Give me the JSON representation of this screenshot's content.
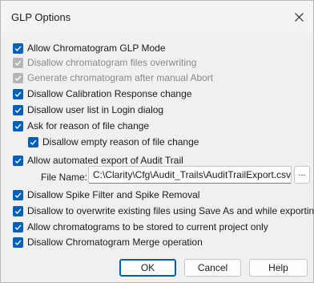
{
  "window": {
    "title": "GLP Options"
  },
  "options": [
    {
      "label": "Allow Chromatogram GLP Mode",
      "checked": true,
      "enabled": true
    },
    {
      "label": "Disallow chromatogram files overwriting",
      "checked": true,
      "enabled": false
    },
    {
      "label": "Generate chromatogram after manual Abort",
      "checked": true,
      "enabled": false
    },
    {
      "label": "Disallow Calibration Response change",
      "checked": true,
      "enabled": true
    },
    {
      "label": "Disallow user list in Login dialog",
      "checked": true,
      "enabled": true
    },
    {
      "label": "Ask for reason of file change",
      "checked": true,
      "enabled": true
    },
    {
      "label": "Disallow empty reason of file change",
      "checked": true,
      "enabled": true
    },
    {
      "label": "Allow automated export of Audit Trail",
      "checked": true,
      "enabled": true
    },
    {
      "label": "Disallow Spike Filter and Spike Removal",
      "checked": true,
      "enabled": true
    },
    {
      "label": "Disallow to overwrite existing files using Save As and while exporting",
      "checked": true,
      "enabled": true
    },
    {
      "label": "Allow chromatograms to be stored to current project only",
      "checked": true,
      "enabled": true
    },
    {
      "label": "Disallow Chromatogram Merge operation",
      "checked": true,
      "enabled": true
    }
  ],
  "file_name": {
    "label": "File Name:",
    "value": "C:\\Clarity\\Cfg\\Audit_Trails\\AuditTrailExport.csv",
    "browse_label": "..."
  },
  "buttons": {
    "ok": "OK",
    "cancel": "Cancel",
    "help": "Help"
  },
  "colors": {
    "accent": "#005fb8",
    "disabled_check": "#b5b5b5",
    "disabled_text": "#8a8a8a",
    "panel": "#f0f0f0"
  }
}
